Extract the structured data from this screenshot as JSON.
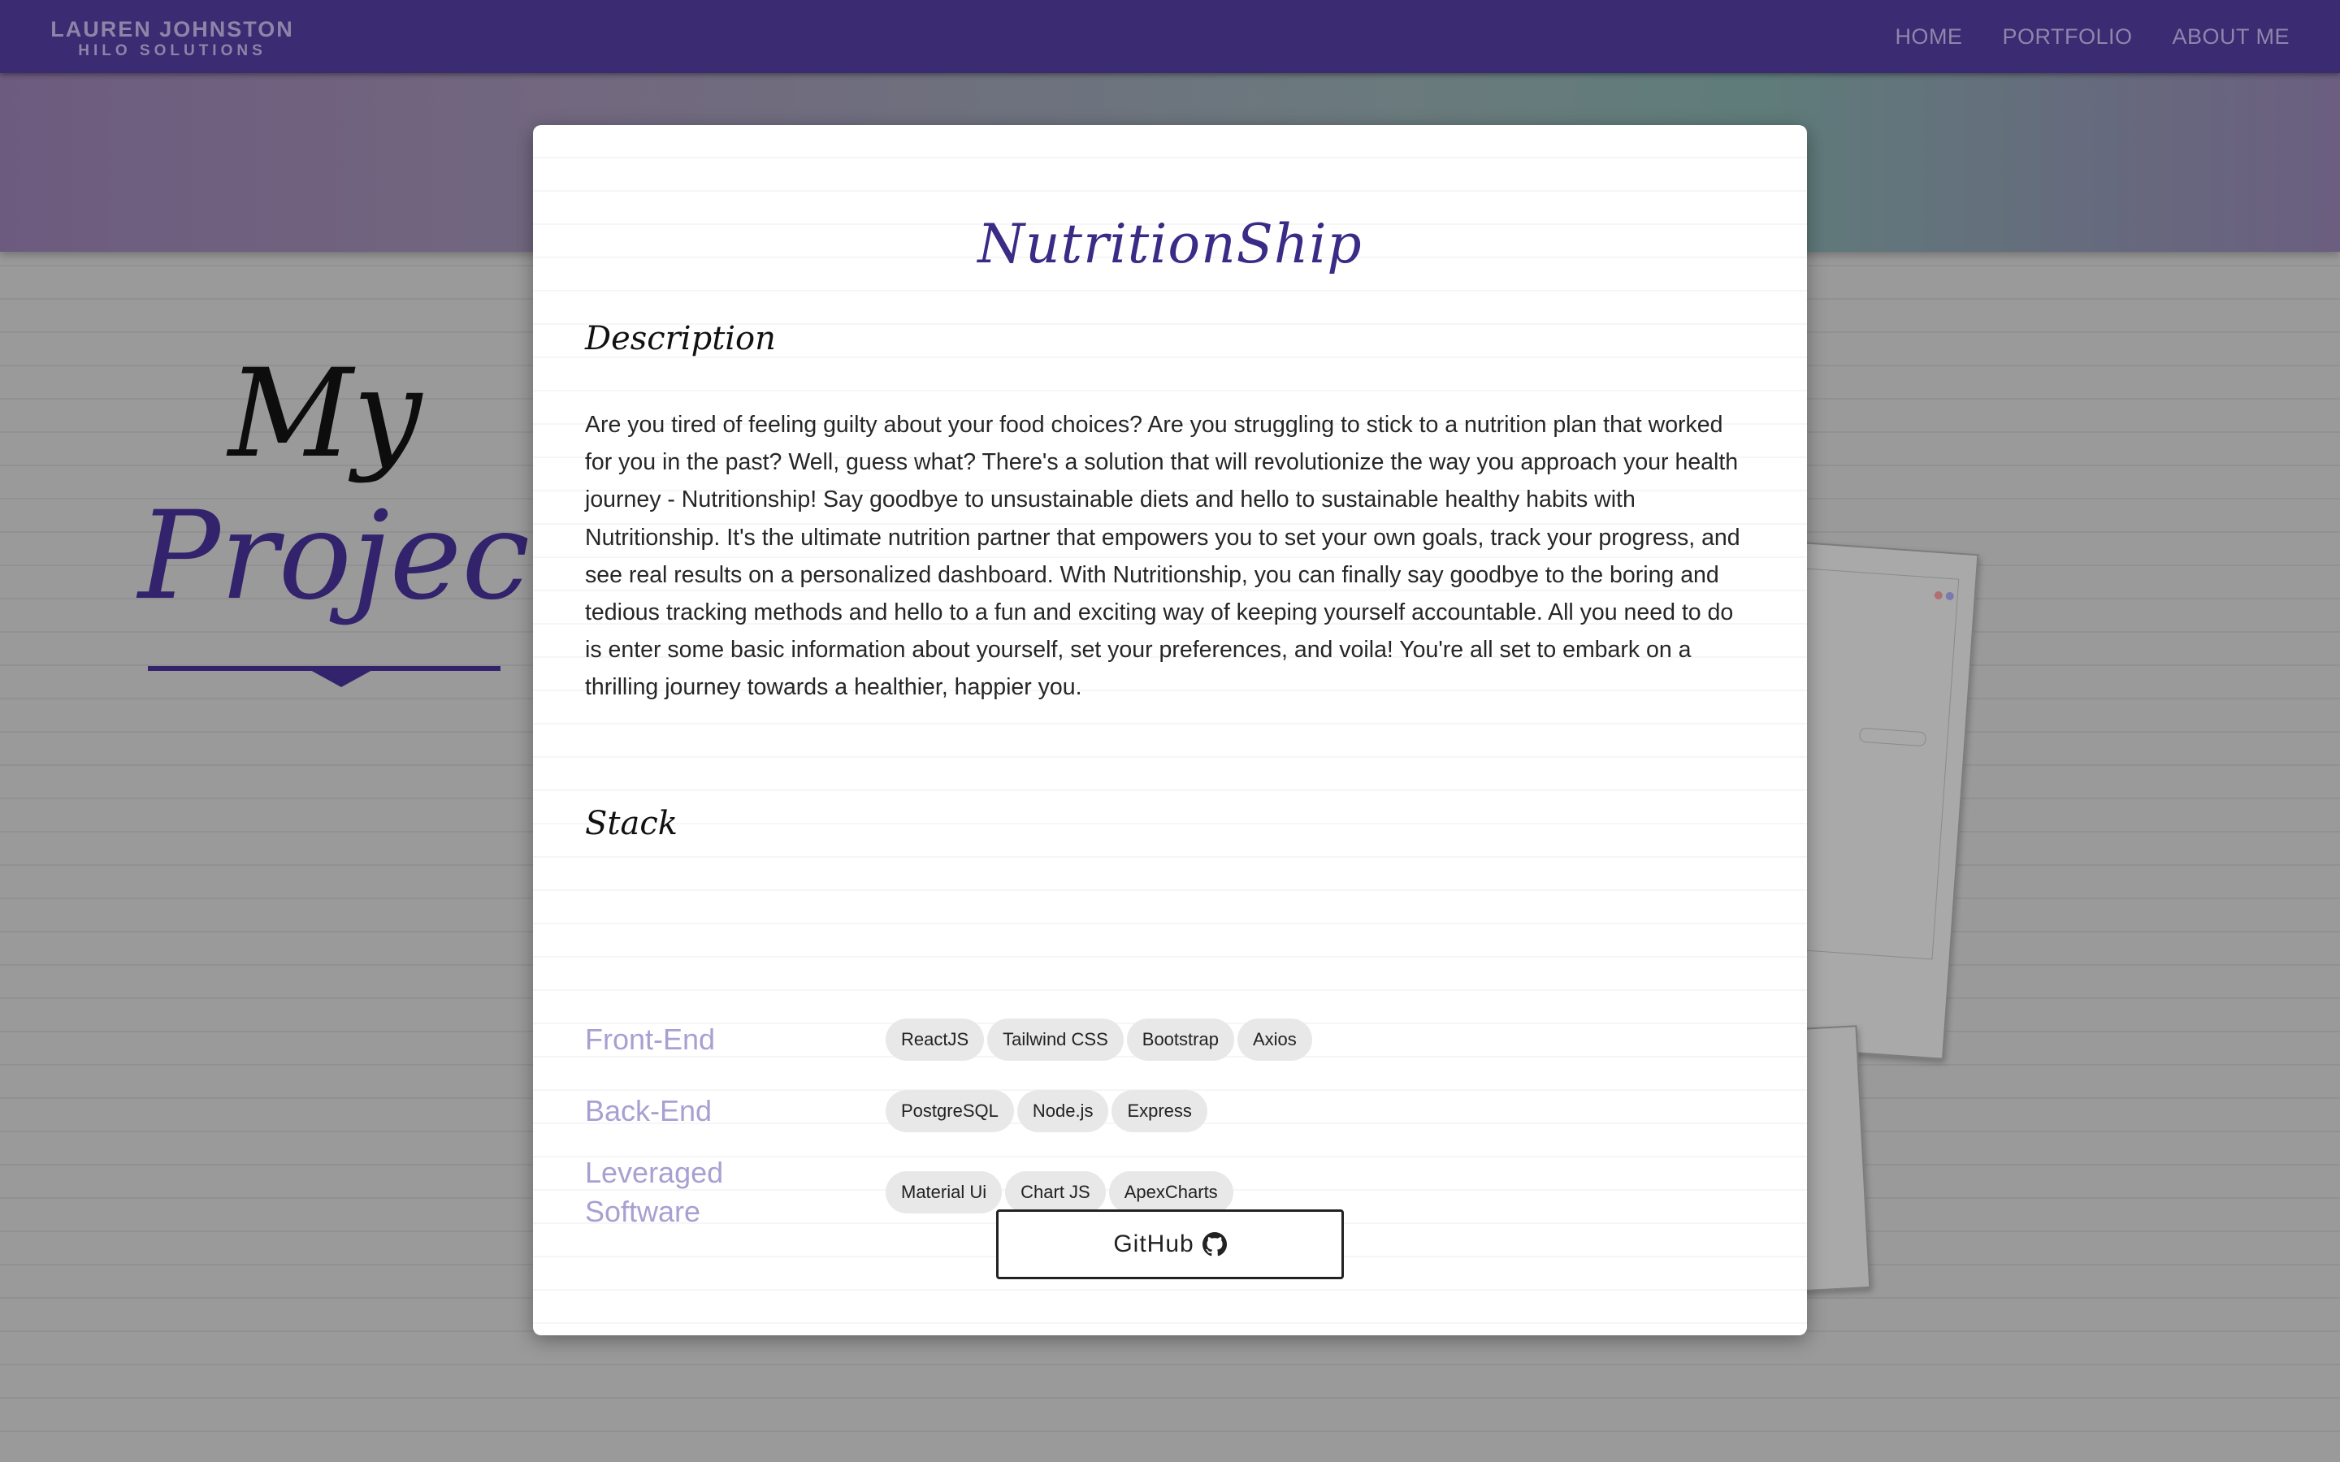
{
  "header": {
    "brand_name": "LAUREN JOHNSTON",
    "brand_sub": "HILO SOLUTIONS",
    "nav": [
      {
        "label": "HOME"
      },
      {
        "label": "PORTFOLIO"
      },
      {
        "label": "ABOUT ME"
      }
    ]
  },
  "side": {
    "line1": "My",
    "line2": "Projects"
  },
  "modal": {
    "title": "NutritionShip",
    "description_heading": "Description",
    "description": "Are you tired of feeling guilty about your food choices? Are you struggling to stick to a nutrition plan that worked for you in the past? Well, guess what? There's a solution that will revolutionize the way you approach your health journey - Nutritionship! Say goodbye to unsustainable diets and hello to sustainable healthy habits with Nutritionship. It's the ultimate nutrition partner that empowers you to set your own goals, track your progress, and see real results on a personalized dashboard. With Nutritionship, you can finally say goodbye to the boring and tedious tracking methods and hello to a fun and exciting way of keeping yourself accountable. All you need to do is enter some basic information about yourself, set your preferences, and voila! You're all set to embark on a thrilling journey towards a healthier, happier you.",
    "stack_heading": "Stack",
    "stack": [
      {
        "label": "Front-End",
        "items": [
          "ReactJS",
          "Tailwind CSS",
          "Bootstrap",
          "Axios"
        ]
      },
      {
        "label": "Back-End",
        "items": [
          "PostgreSQL",
          "Node.js",
          "Express"
        ]
      },
      {
        "label": "Leveraged Software",
        "items": [
          "Material Ui",
          "Chart JS",
          "ApexCharts"
        ]
      }
    ],
    "github_label": "GitHub"
  },
  "colors": {
    "topbar": "#3a2b72",
    "accent": "#33236d",
    "title": "#3a2b86",
    "stack_label": "#a89fd2"
  },
  "icons": {
    "github": "github-icon"
  }
}
